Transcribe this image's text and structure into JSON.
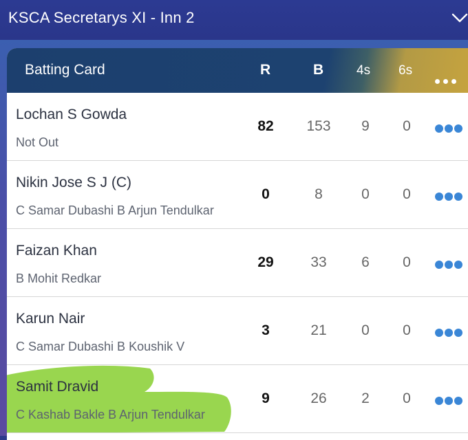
{
  "header": {
    "title": "KSCA Secretarys XI - Inn 2"
  },
  "card": {
    "title": "Batting Card",
    "columns": {
      "runs": "R",
      "balls": "B",
      "fours": "4s",
      "sixes": "6s"
    }
  },
  "rows": [
    {
      "name": "Lochan S Gowda",
      "dismissal": "Not Out",
      "runs": "82",
      "balls": "153",
      "fours": "9",
      "sixes": "0"
    },
    {
      "name": "Nikin Jose S J (C)",
      "dismissal": "C Samar Dubashi B Arjun Tendulkar",
      "runs": "0",
      "balls": "8",
      "fours": "0",
      "sixes": "0"
    },
    {
      "name": "Faizan Khan",
      "dismissal": "B Mohit Redkar",
      "runs": "29",
      "balls": "33",
      "fours": "6",
      "sixes": "0"
    },
    {
      "name": "Karun Nair",
      "dismissal": "C Samar Dubashi B Koushik V",
      "runs": "3",
      "balls": "21",
      "fours": "0",
      "sixes": "0"
    },
    {
      "name": "Samit Dravid",
      "dismissal": "C Kashab Bakle B Arjun Tendulkar",
      "runs": "9",
      "balls": "26",
      "fours": "2",
      "sixes": "0"
    }
  ],
  "colors": {
    "header_bg": "#2c3a92",
    "card_header": "#1d4270",
    "accent_gold": "#c7a43e",
    "dots_blue": "#3a86d6",
    "highlight_green": "#8ed13c"
  }
}
